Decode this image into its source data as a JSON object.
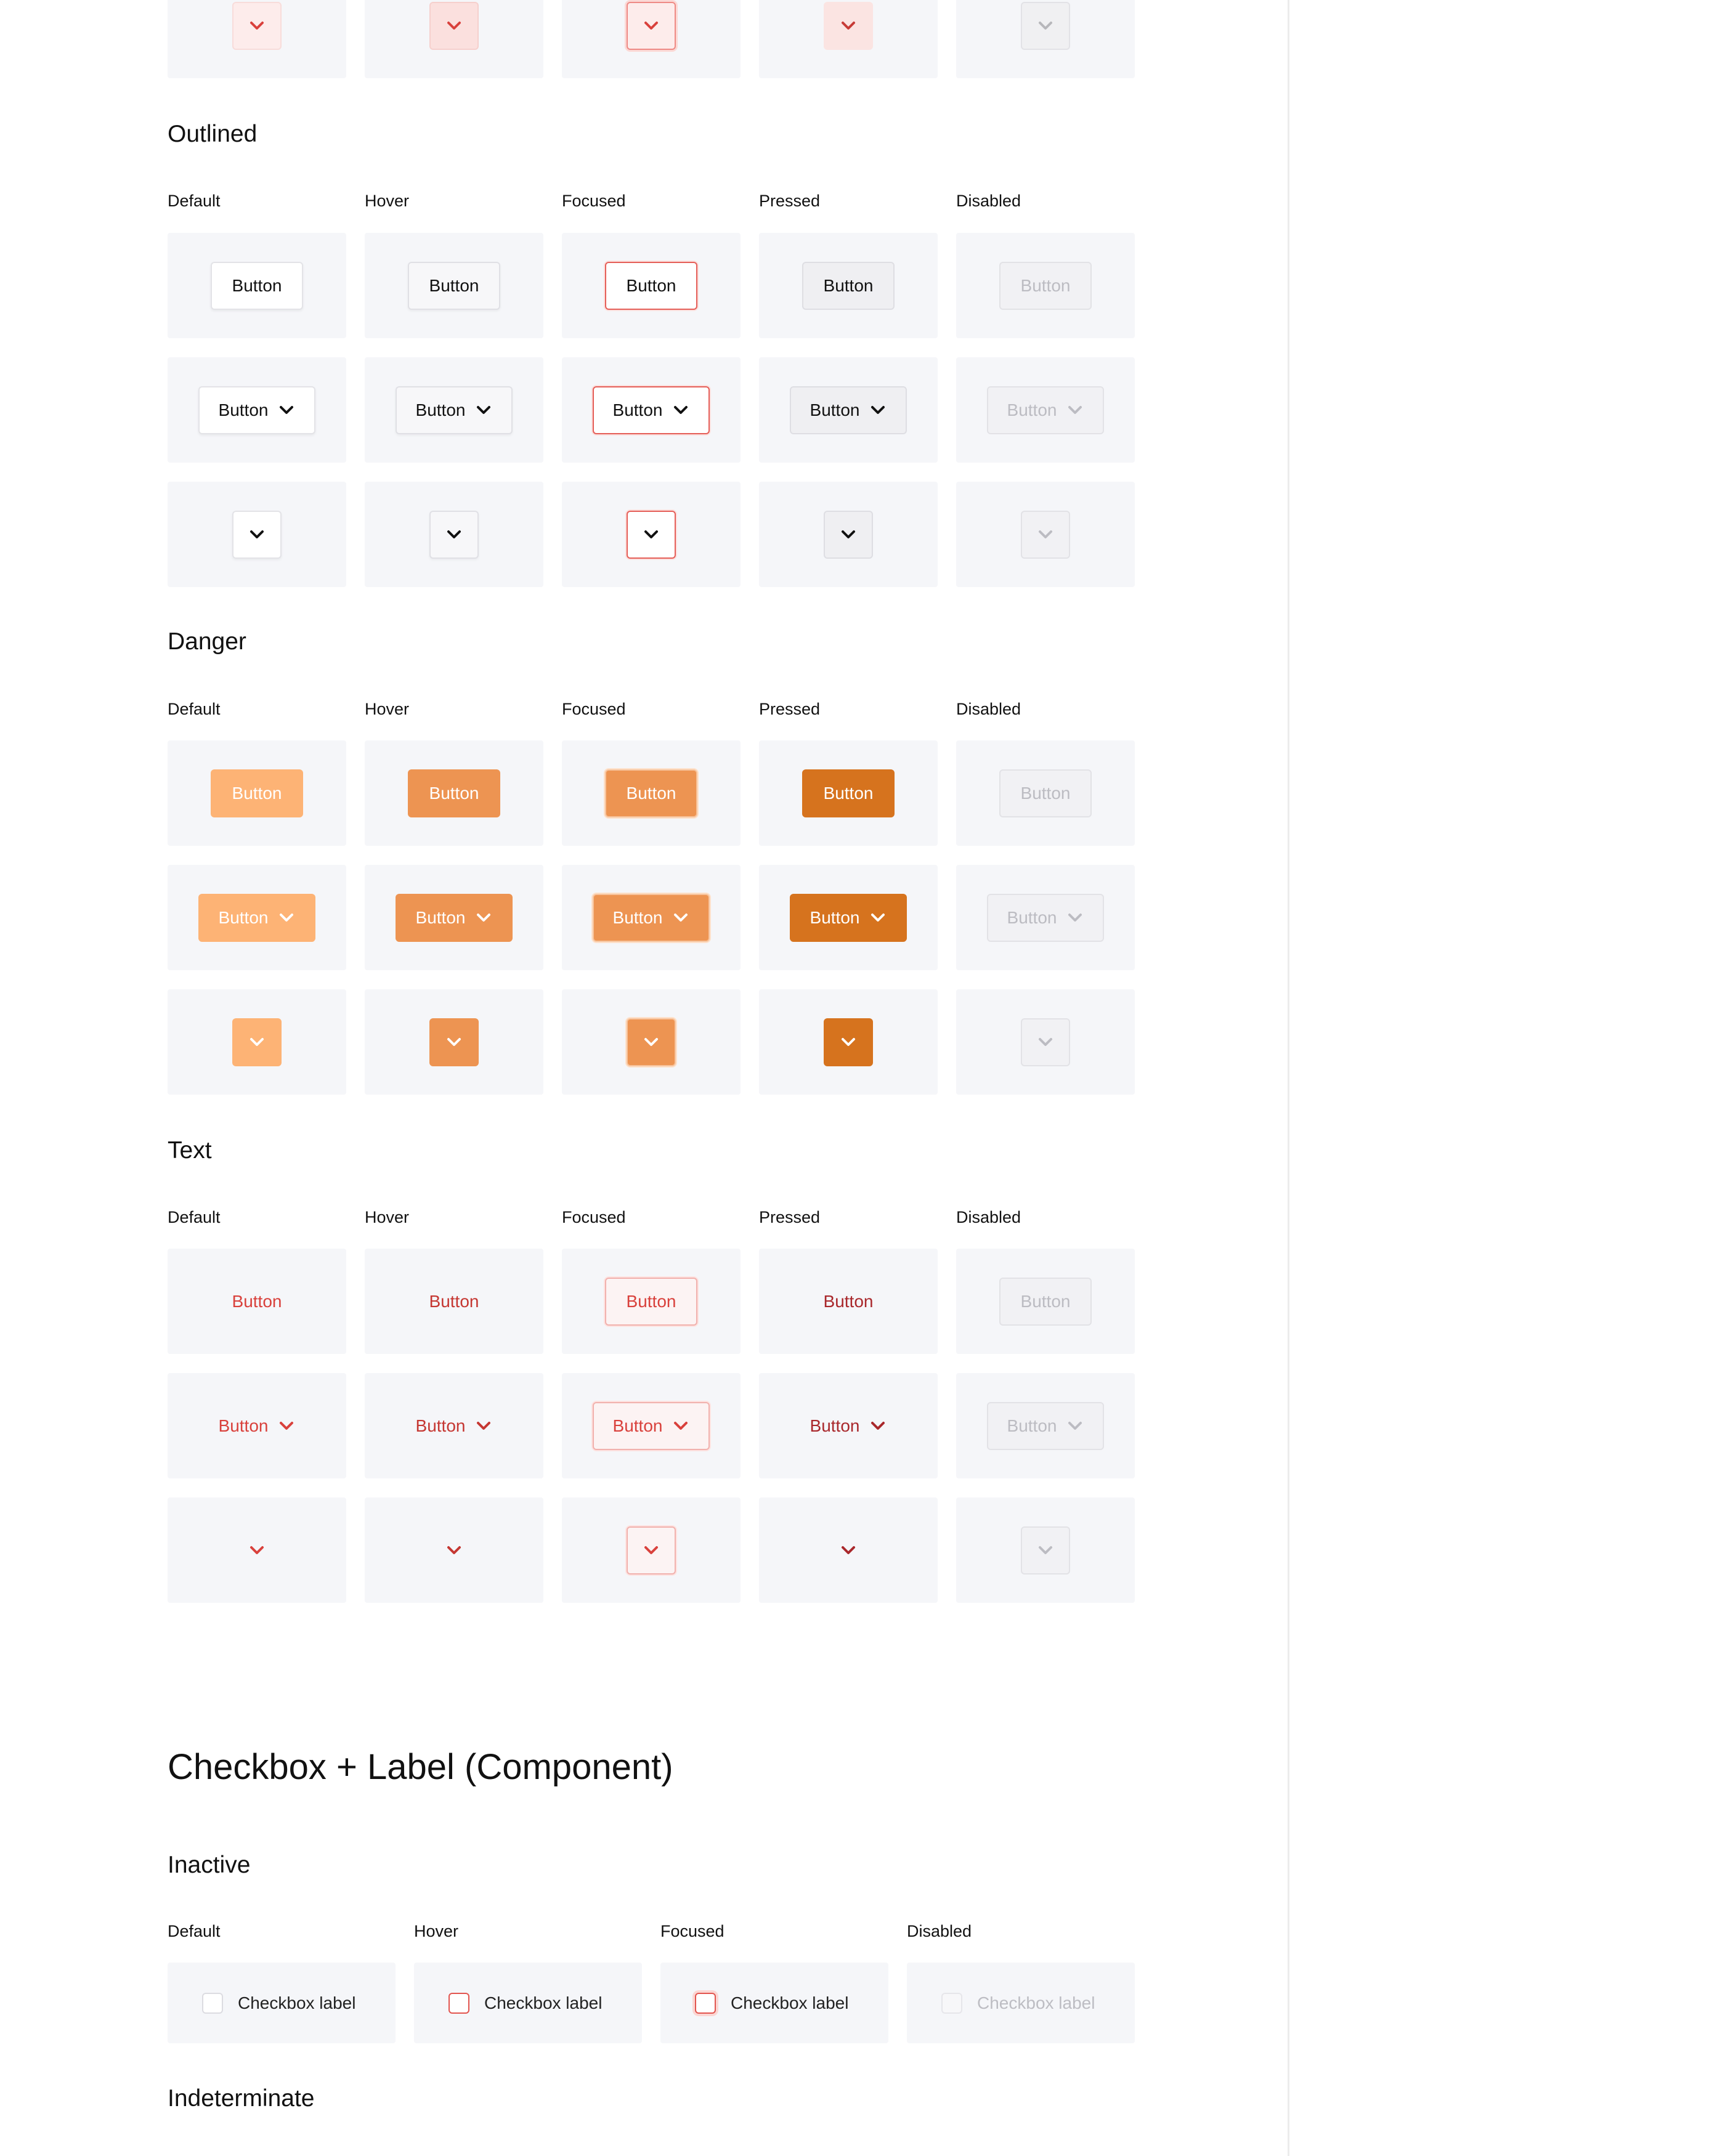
{
  "states": [
    "Default",
    "Hover",
    "Focused",
    "Pressed",
    "Disabled"
  ],
  "button_label": "Button",
  "sections": {
    "outlined": "Outlined",
    "danger": "Danger",
    "text": "Text"
  },
  "checkbox_component": {
    "title": "Checkbox + Label (Component)",
    "inactive_heading": "Inactive",
    "states": [
      "Default",
      "Hover",
      "Focused",
      "Disabled"
    ],
    "label": "Checkbox label",
    "indeterminate_heading": "Indeterminate"
  },
  "colors": {
    "filled_accent": "#d9413c",
    "danger_default": "#fdb375",
    "danger_hover": "#ed9452",
    "danger_pressed": "#d6731e",
    "text_accent": "#d9413c",
    "cell_background": "#f5f6f9"
  },
  "icons": {
    "dropdown": "chevron-down-icon"
  }
}
